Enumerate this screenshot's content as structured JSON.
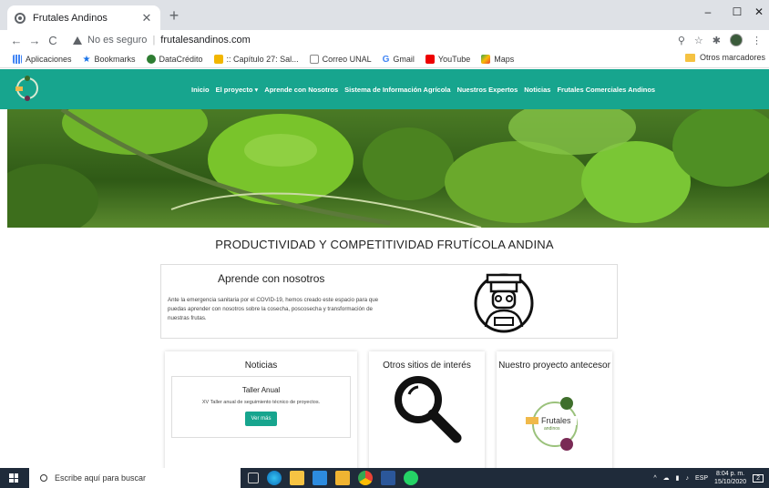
{
  "browser": {
    "tab_title": "Frutales Andinos",
    "tab_close": "✕",
    "new_tab": "+",
    "security_label": "No es seguro",
    "url": "frutalesandinos.com",
    "min": "–",
    "max": "☐",
    "close": "✕"
  },
  "bookmarks": {
    "items": [
      {
        "label": "Aplicaciones"
      },
      {
        "label": "Bookmarks"
      },
      {
        "label": "DataCrédito"
      },
      {
        "label": ":: Capítulo 27: Sal..."
      },
      {
        "label": "Correo UNAL"
      },
      {
        "label": "Gmail"
      },
      {
        "label": "YouTube"
      },
      {
        "label": "Maps"
      }
    ],
    "other": "Otros marcadores"
  },
  "site": {
    "nav": [
      "Inicio",
      "El proyecto ▾",
      "Aprende con Nosotros",
      "Sistema de Información Agrícola",
      "Nuestros Expertos",
      "Noticias",
      "Frutales Comerciales Andinos"
    ],
    "heading": "PRODUCTIVIDAD Y COMPETITIVIDAD FRUTÍCOLA ANDINA",
    "learn": {
      "title": "Aprende con nosotros",
      "text": "Ante la emergencia sanitaria por el COVID-19, hemos creado este espacio para que puedas aprender con nosotros sobre la cosecha, poscosecha y transformación de nuestras frutas."
    },
    "news": {
      "title": "Noticias",
      "item_title": "Taller Anual",
      "item_text": "XV Taller anual de seguimiento técnico de proyectos.",
      "button": "Ver más"
    },
    "other_sites": {
      "title": "Otros sitios de interés"
    },
    "previous": {
      "title": "Nuestro proyecto antecesor",
      "logo_text": "Frutales",
      "logo_sub": "andinos"
    }
  },
  "taskbar": {
    "search_placeholder": "Escribe aquí para buscar",
    "lang": "ESP",
    "time": "8:04 p. m.",
    "date": "15/10/2020",
    "notif": "2"
  }
}
